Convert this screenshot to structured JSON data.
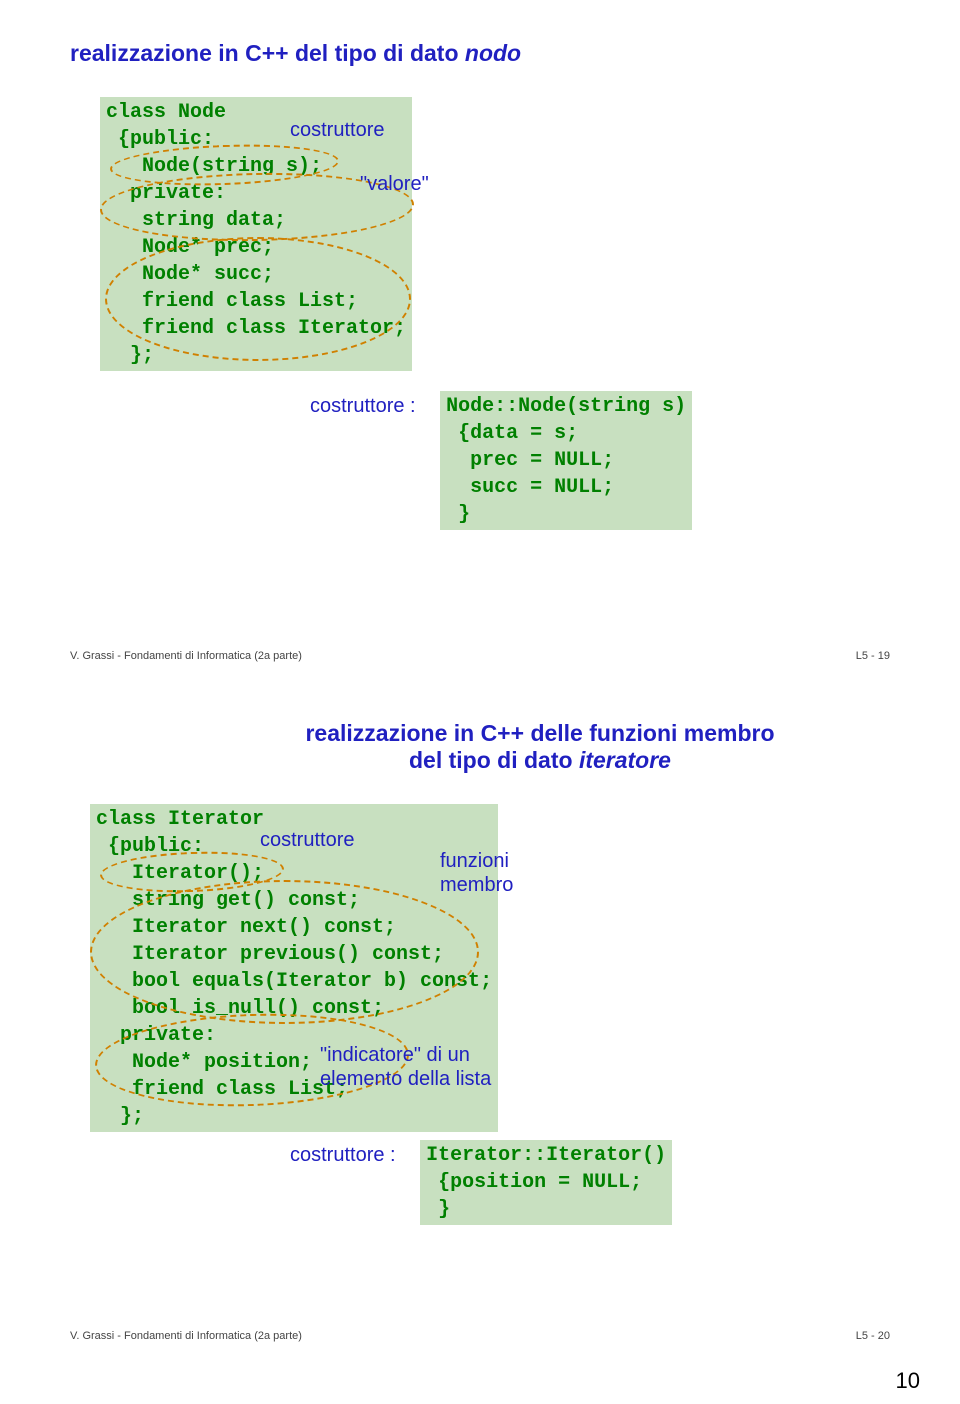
{
  "slide1": {
    "title_plain": "realizzazione in C++ del tipo di dato ",
    "title_italic": "nodo",
    "code": {
      "l1": "class Node",
      "l2": " {public:",
      "l3": "   Node(string s);",
      "l4": "  private:",
      "l5": "   string data;",
      "l6": "   Node* prec;",
      "l7": "   Node* succ;",
      "l8": "   friend class List;",
      "l9": "   friend class Iterator;",
      "l10": "  };"
    },
    "ann_costruttore": "costruttore",
    "ann_valore": "\"valore\"",
    "ctor_label": "costruttore :",
    "ctor_code": {
      "l1": "Node::Node(string s)",
      "l2": " {data = s;",
      "l3": "  prec = NULL;",
      "l4": "  succ = NULL;",
      "l5": " }"
    },
    "footer_left": "V. Grassi - Fondamenti di Informatica (2a parte)",
    "footer_right": "L5 - 19"
  },
  "slide2": {
    "title_line1": "realizzazione in C++ delle funzioni membro",
    "title_line2_plain": "del tipo di dato ",
    "title_line2_italic": "iteratore",
    "code": {
      "l1": "class Iterator",
      "l2": " {public:",
      "l3": "   Iterator();",
      "l4": "   string get() const;",
      "l5": "   Iterator next() const;",
      "l6": "   Iterator previous() const;",
      "l7": "   bool equals(Iterator b) const;",
      "l8": "   bool is_null() const;",
      "l9": "  private:",
      "l10": "   Node* position;",
      "l11": "   friend class List;",
      "l12": "  };"
    },
    "ann_costruttore": "costruttore",
    "ann_funzioni": "funzioni",
    "ann_membro": "membro",
    "ann_indicatore": "\"indicatore\" di un",
    "ann_elemento": "elemento della lista",
    "ctor_label": "costruttore :",
    "ctor_code": {
      "l1": "Iterator::Iterator()",
      "l2": " {position = NULL;",
      "l3": " }"
    },
    "footer_left": "V. Grassi - Fondamenti di Informatica (2a parte)",
    "footer_right": "L5 - 20"
  },
  "page_number": "10"
}
